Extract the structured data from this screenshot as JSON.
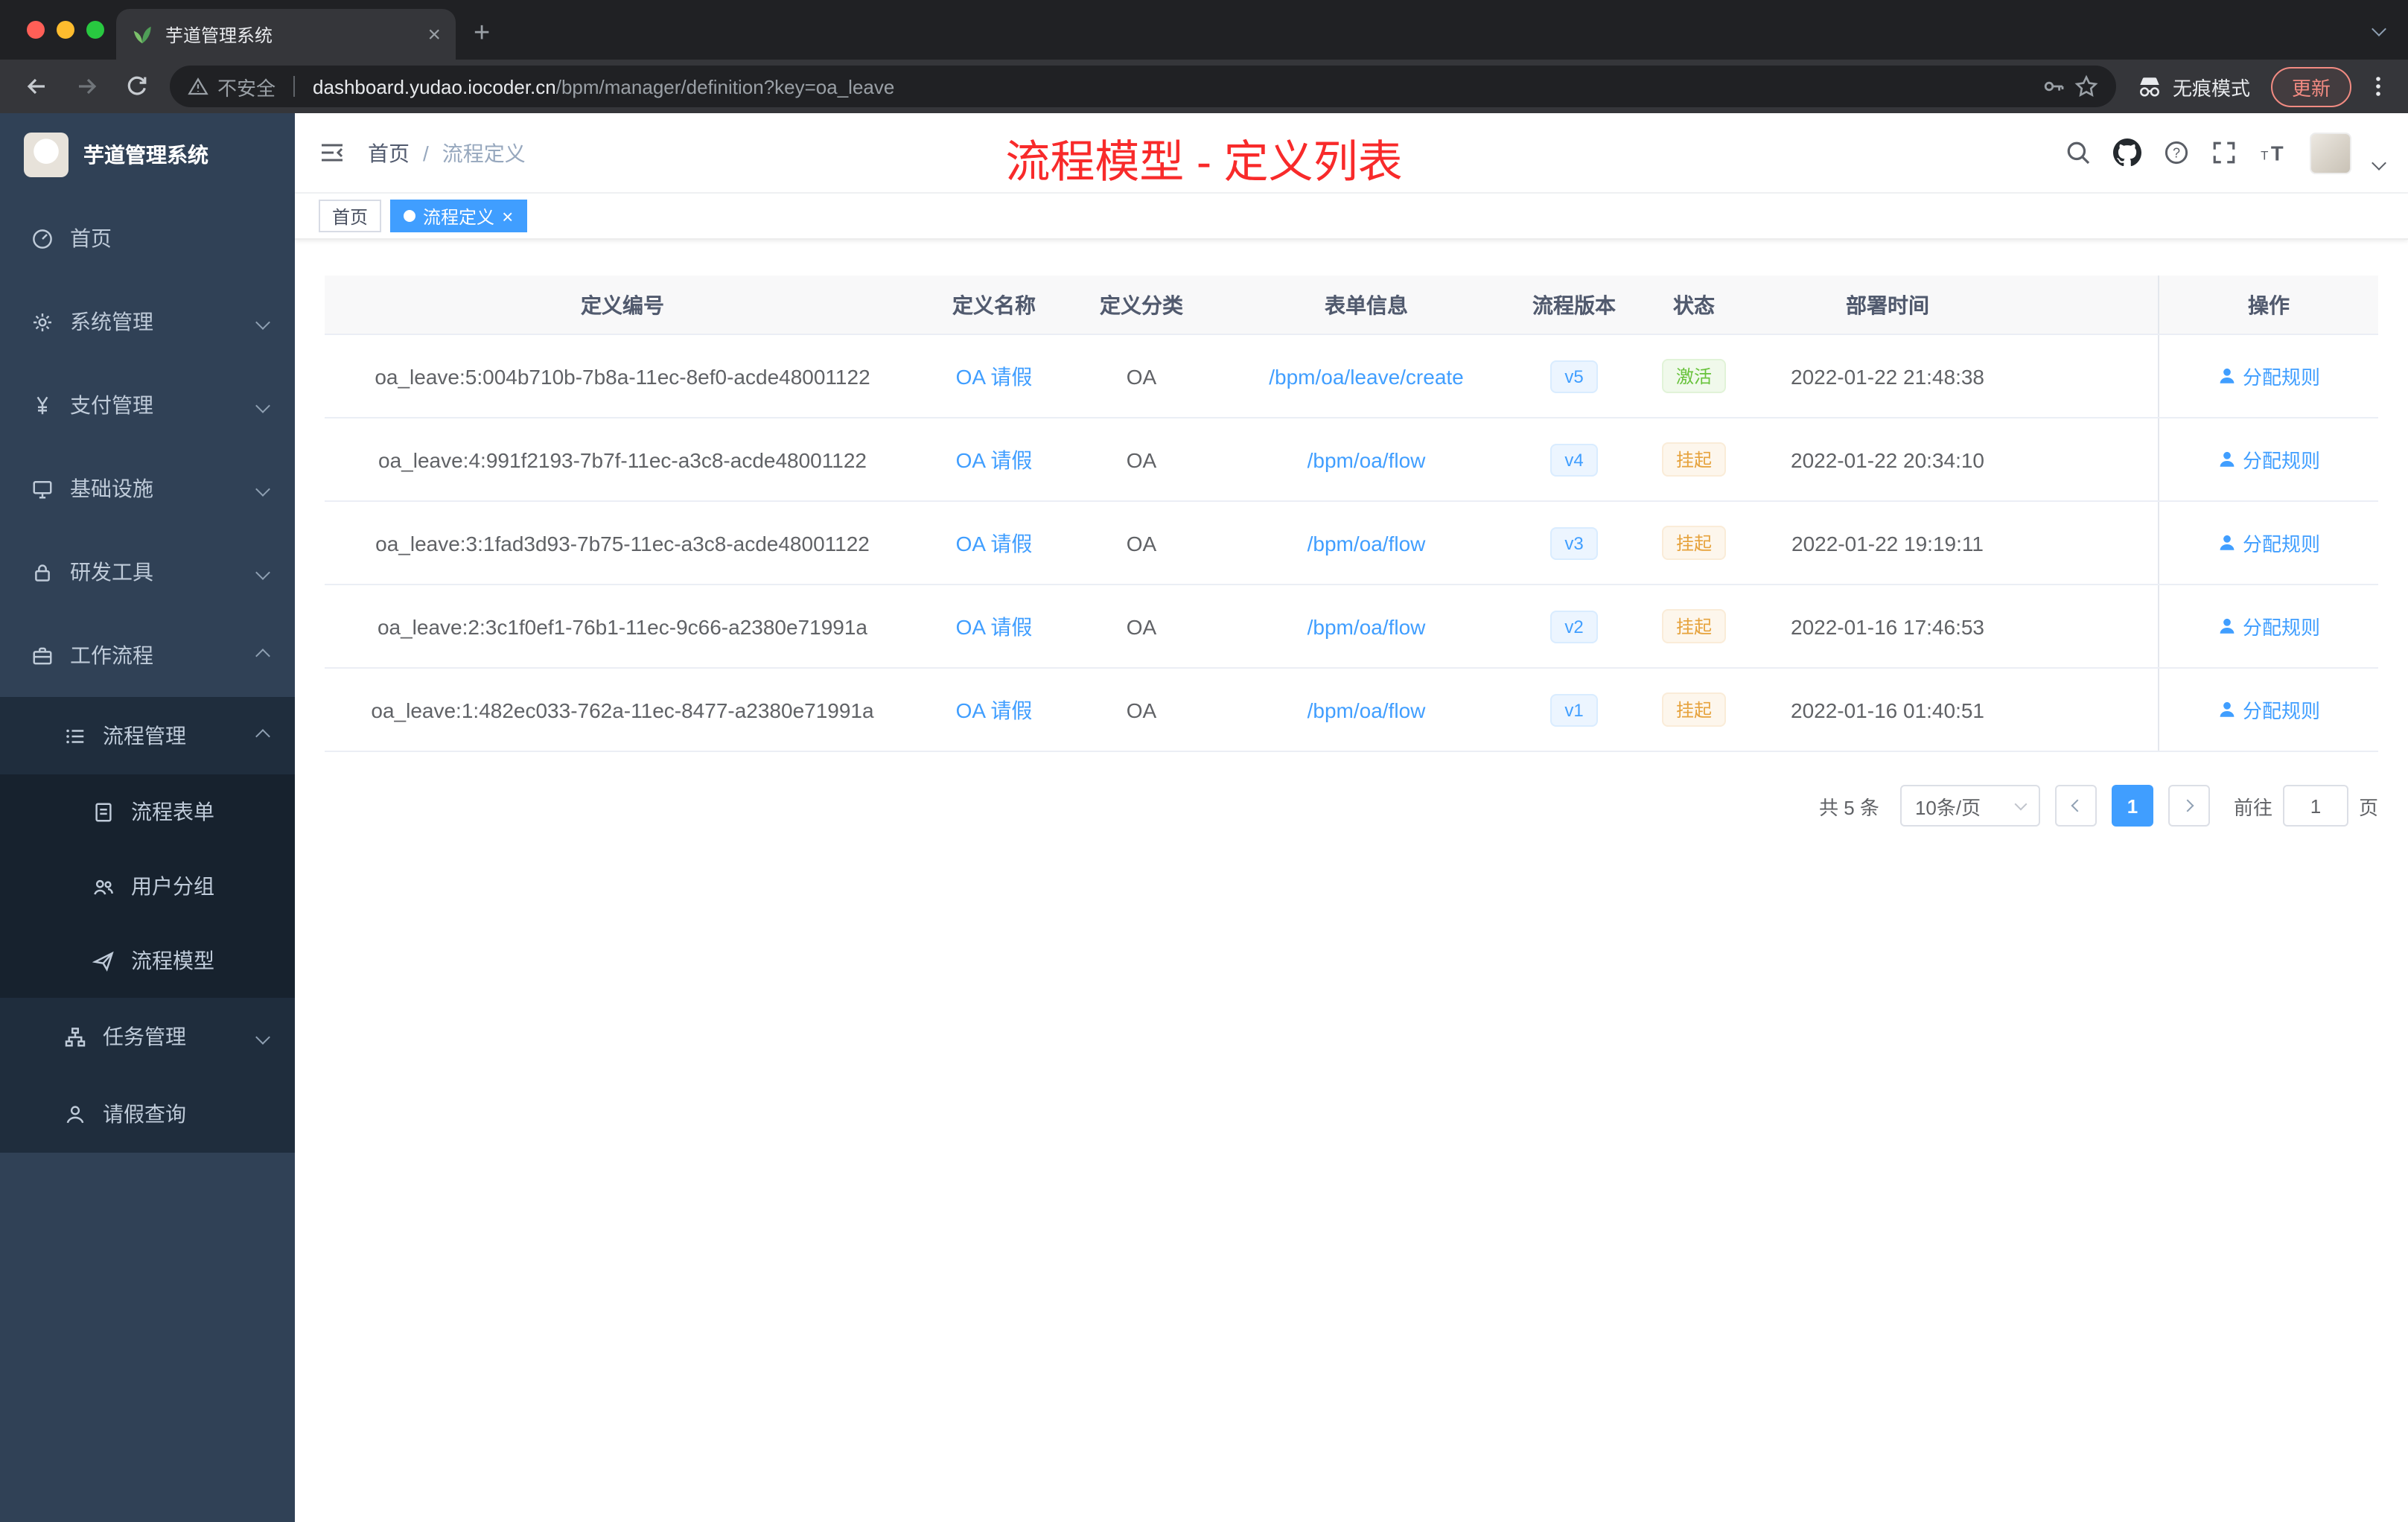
{
  "colors": {
    "accent": "#409eff",
    "title_red": "#f82a2a",
    "sidebar_bg": "#304156"
  },
  "browser": {
    "tab_title": "芋道管理系统",
    "security_label": "不安全",
    "url_host": "dashboard.yudao.iocoder.cn",
    "url_path": "/bpm/manager/definition?key=oa_leave",
    "incognito_label": "无痕模式",
    "update_label": "更新"
  },
  "sidebar": {
    "app_title": "芋道管理系统",
    "items": [
      {
        "label": "首页"
      },
      {
        "label": "系统管理"
      },
      {
        "label": "支付管理"
      },
      {
        "label": "基础设施"
      },
      {
        "label": "研发工具"
      },
      {
        "label": "工作流程"
      },
      {
        "label": "流程管理"
      },
      {
        "label": "流程表单"
      },
      {
        "label": "用户分组"
      },
      {
        "label": "流程模型"
      },
      {
        "label": "任务管理"
      },
      {
        "label": "请假查询"
      }
    ]
  },
  "header": {
    "breadcrumb_home": "首页",
    "breadcrumb_current": "流程定义",
    "overlay_title": "流程模型 - 定义列表"
  },
  "tags": {
    "home": "首页",
    "active": "流程定义"
  },
  "table": {
    "columns": [
      "定义编号",
      "定义名称",
      "定义分类",
      "表单信息",
      "流程版本",
      "状态",
      "部署时间",
      "操作"
    ],
    "rows": [
      {
        "id": "oa_leave:5:004b710b-7b8a-11ec-8ef0-acde48001122",
        "name": "OA 请假",
        "category": "OA",
        "form": "/bpm/oa/leave/create",
        "version": "v5",
        "status": "激活",
        "time": "2022-01-22 21:48:38",
        "action": "分配规则"
      },
      {
        "id": "oa_leave:4:991f2193-7b7f-11ec-a3c8-acde48001122",
        "name": "OA 请假",
        "category": "OA",
        "form": "/bpm/oa/flow",
        "version": "v4",
        "status": "挂起",
        "time": "2022-01-22 20:34:10",
        "action": "分配规则"
      },
      {
        "id": "oa_leave:3:1fad3d93-7b75-11ec-a3c8-acde48001122",
        "name": "OA 请假",
        "category": "OA",
        "form": "/bpm/oa/flow",
        "version": "v3",
        "status": "挂起",
        "time": "2022-01-22 19:19:11",
        "action": "分配规则"
      },
      {
        "id": "oa_leave:2:3c1f0ef1-76b1-11ec-9c66-a2380e71991a",
        "name": "OA 请假",
        "category": "OA",
        "form": "/bpm/oa/flow",
        "version": "v2",
        "status": "挂起",
        "time": "2022-01-16 17:46:53",
        "action": "分配规则"
      },
      {
        "id": "oa_leave:1:482ec033-762a-11ec-8477-a2380e71991a",
        "name": "OA 请假",
        "category": "OA",
        "form": "/bpm/oa/flow",
        "version": "v1",
        "status": "挂起",
        "time": "2022-01-16 01:40:51",
        "action": "分配规则"
      }
    ]
  },
  "pagination": {
    "total": "共 5 条",
    "page_size": "10条/页",
    "current_page": "1",
    "goto_label": "前往",
    "goto_value": "1",
    "page_unit": "页"
  }
}
